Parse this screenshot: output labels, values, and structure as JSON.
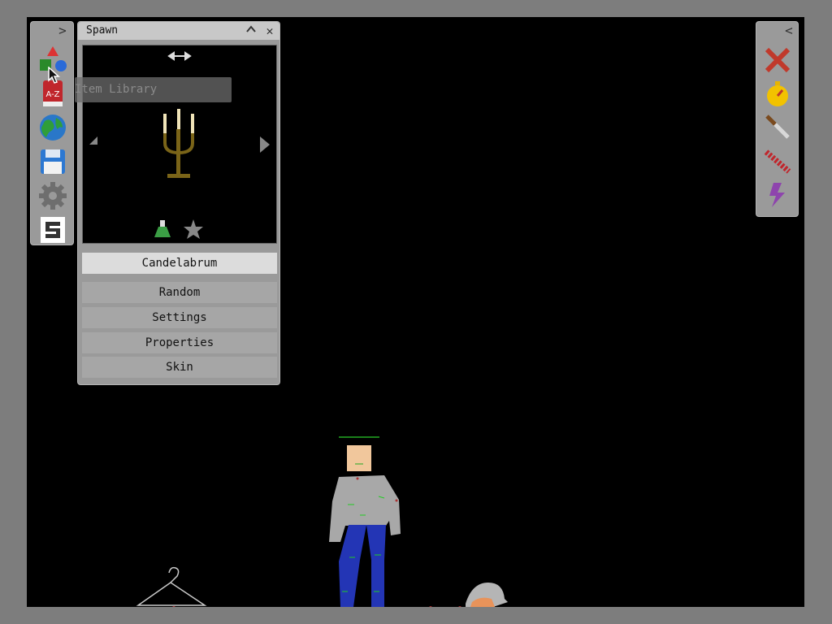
{
  "spawn_panel": {
    "title": "Spawn",
    "item_name": "Candelabrum",
    "buttons": [
      "Random",
      "Settings",
      "Properties",
      "Skin"
    ],
    "minimize_glyph": "^",
    "close_glyph": "✕"
  },
  "left_toolbar": {
    "expand_glyph": ">",
    "tools": [
      "shapes-icon",
      "item-library-icon",
      "world-icon",
      "save-icon",
      "settings-gear-icon",
      "s-logo-icon"
    ],
    "library_badge": "A-Z"
  },
  "tooltip": {
    "text": "Item Library"
  },
  "right_toolbar": {
    "collapse_glyph": "<",
    "tools": [
      "delete-x-icon",
      "timer-icon",
      "knife-icon",
      "chain-icon",
      "lightning-icon"
    ]
  },
  "colors": {
    "background": "#000000",
    "frame": "#7d7d7d",
    "panel": "#9a9a9a",
    "accent_red": "#c0392b",
    "lightning_purple": "#8e44ad"
  }
}
